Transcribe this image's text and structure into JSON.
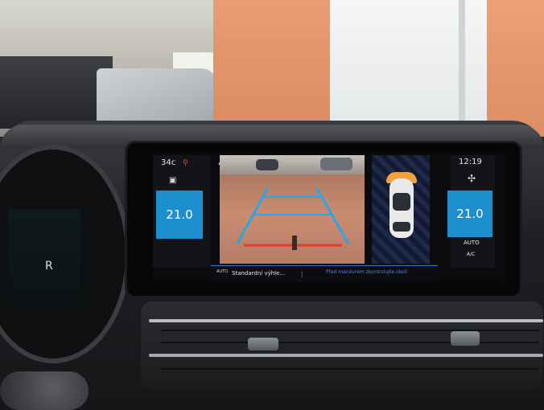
{
  "climate": {
    "outside_temp": "34c",
    "left_temp": "21.0",
    "right_temp": "21.0",
    "auto_label": "AUTO",
    "ac_label": "A/C"
  },
  "clock": "12:19",
  "gear": "R",
  "camera": {
    "mode_icon_label": "AUTO",
    "mode_text": "Standardní výhle...",
    "divider": "|",
    "hint_text": "Před manévrem zkontrolujte okolí"
  },
  "icons": {
    "back": "←",
    "location_pin": "⚲",
    "seat_heat": "▣",
    "fan": "✣"
  },
  "colors": {
    "accent_blue": "#1d8fcf",
    "guide_blue": "#2aa6e8",
    "guide_red": "#e83a2a",
    "sensor_orange": "#f2a23c",
    "hint_blue": "#3e8de0"
  }
}
